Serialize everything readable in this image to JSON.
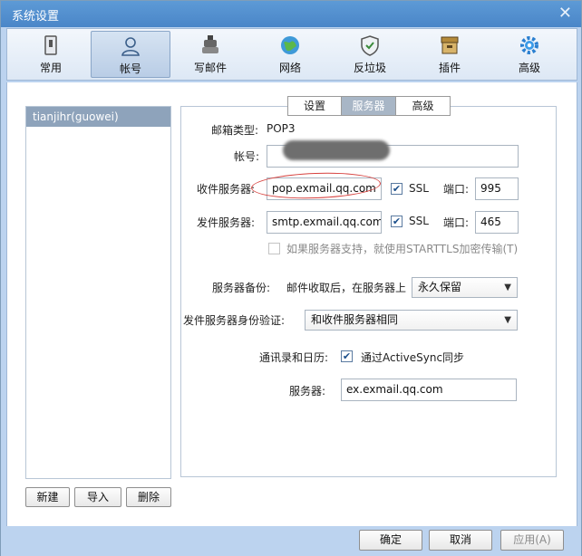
{
  "window": {
    "title": "系统设置"
  },
  "toolbar": {
    "items": [
      {
        "label": "常用",
        "icon": "general-icon"
      },
      {
        "label": "帐号",
        "icon": "account-icon"
      },
      {
        "label": "写邮件",
        "icon": "compose-icon"
      },
      {
        "label": "网络",
        "icon": "network-icon"
      },
      {
        "label": "反垃圾",
        "icon": "antispam-icon"
      },
      {
        "label": "插件",
        "icon": "plugin-icon"
      },
      {
        "label": "高级",
        "icon": "advanced-icon"
      }
    ],
    "active": "帐号"
  },
  "accounts": {
    "items": [
      "tianjihr(guowei)"
    ]
  },
  "account_buttons": {
    "new": "新建",
    "import": "导入",
    "delete": "删除"
  },
  "tabs": {
    "items": [
      "设置",
      "服务器",
      "高级"
    ],
    "active": "服务器"
  },
  "server": {
    "mail_type_label": "邮箱类型:",
    "mail_type": "POP3",
    "account_label": "帐号:",
    "account_value": "",
    "incoming_label": "收件服务器:",
    "incoming_server": "pop.exmail.qq.com",
    "ssl_label": "SSL",
    "port_label": "端口:",
    "incoming_port": "995",
    "outgoing_label": "发件服务器:",
    "outgoing_server": "smtp.exmail.qq.com",
    "outgoing_port": "465",
    "starttls_label": "如果服务器支持，就使用STARTTLS加密传输(T)",
    "backup_label": "服务器备份:",
    "backup_desc": "邮件收取后，在服务器上",
    "backup_value": "永久保留",
    "auth_label": "发件服务器身份验证:",
    "auth_value": "和收件服务器相同",
    "contacts_label": "通讯录和日历:",
    "activesync_label": "通过ActiveSync同步",
    "as_server_label": "服务器:",
    "as_server_value": "ex.exmail.qq.com"
  },
  "footer": {
    "ok": "确定",
    "cancel": "取消",
    "apply": "应用(A)"
  }
}
